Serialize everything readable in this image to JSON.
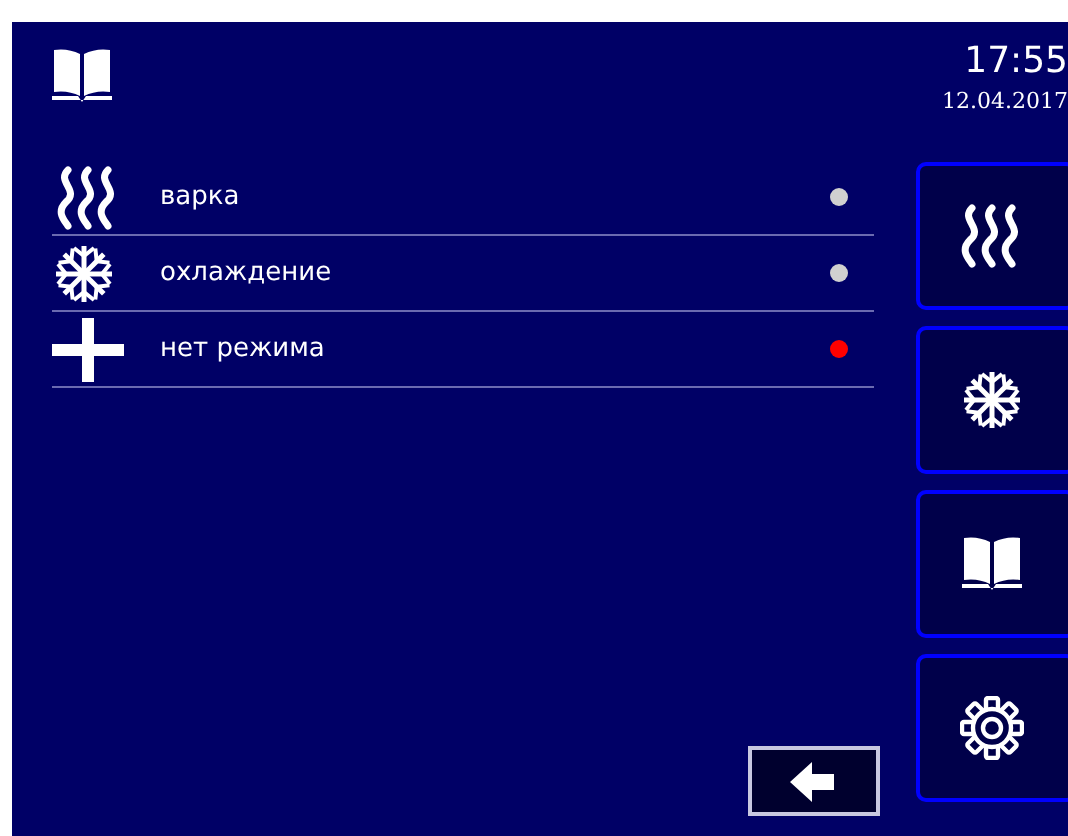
{
  "header": {
    "time": "17:55",
    "date": "12.04.2017"
  },
  "modes": [
    {
      "kind": "steam",
      "label": "варка",
      "color": "#d0d0d0"
    },
    {
      "kind": "snow",
      "label": "охлаждение",
      "color": "#d0d0d0"
    },
    {
      "kind": "plus",
      "label": "нет режима",
      "color": "#ff0000"
    }
  ],
  "side_buttons": [
    {
      "kind": "steam"
    },
    {
      "kind": "snow"
    },
    {
      "kind": "book"
    },
    {
      "kind": "gear"
    }
  ]
}
